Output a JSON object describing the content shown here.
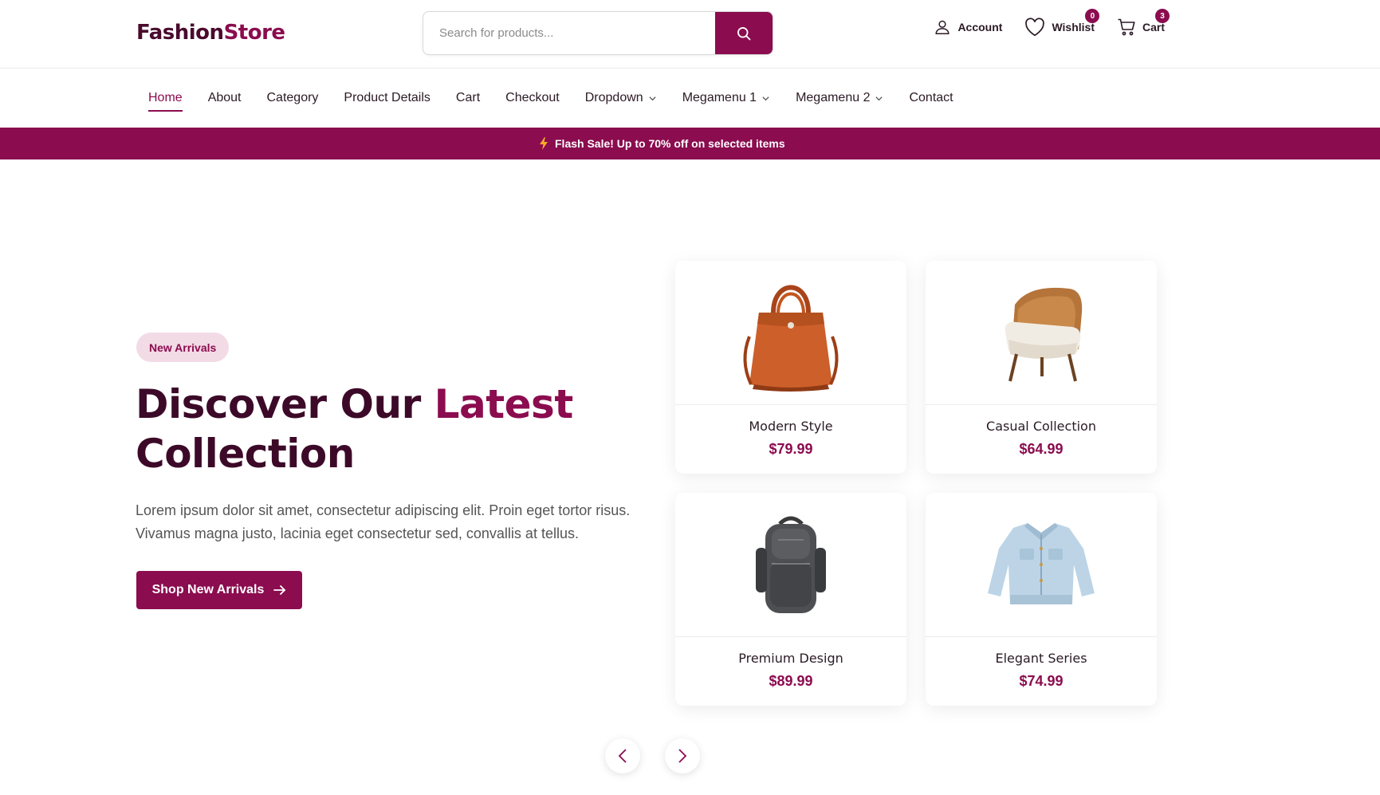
{
  "brand": {
    "name_part1": "Fashion",
    "name_part2": "Store"
  },
  "search": {
    "placeholder": "Search for products..."
  },
  "header_actions": {
    "account_label": "Account",
    "wishlist_label": "Wishlist",
    "wishlist_count": "0",
    "cart_label": "Cart",
    "cart_count": "3"
  },
  "nav": {
    "items": [
      {
        "label": "Home",
        "active": true
      },
      {
        "label": "About"
      },
      {
        "label": "Category"
      },
      {
        "label": "Product Details"
      },
      {
        "label": "Cart"
      },
      {
        "label": "Checkout"
      },
      {
        "label": "Dropdown",
        "has_dropdown": true
      },
      {
        "label": "Megamenu 1",
        "has_dropdown": true
      },
      {
        "label": "Megamenu 2",
        "has_dropdown": true
      },
      {
        "label": "Contact"
      }
    ]
  },
  "flash_sale": {
    "text": "Flash Sale! Up to 70% off on selected items"
  },
  "hero": {
    "badge": "New Arrivals",
    "title_part1": "Discover Our ",
    "title_highlight": "Latest",
    "title_part2": "Collection",
    "description": "Lorem ipsum dolor sit amet, consectetur adipiscing elit. Proin eget tortor risus. Vivamus magna justo, lacinia eget consectetur sed, convallis at tellus.",
    "cta_label": "Shop New Arrivals"
  },
  "products": [
    {
      "name": "Modern Style",
      "price": "$79.99",
      "image": "orange-handbag"
    },
    {
      "name": "Casual Collection",
      "price": "$64.99",
      "image": "wooden-armchair"
    },
    {
      "name": "Premium Design",
      "price": "$89.99",
      "image": "gray-backpack"
    },
    {
      "name": "Elegant Series",
      "price": "$74.99",
      "image": "denim-jacket"
    }
  ],
  "colors": {
    "primary": "#8b0c4f",
    "dark": "#3c0a28",
    "accent_light": "#f3dbe6"
  }
}
